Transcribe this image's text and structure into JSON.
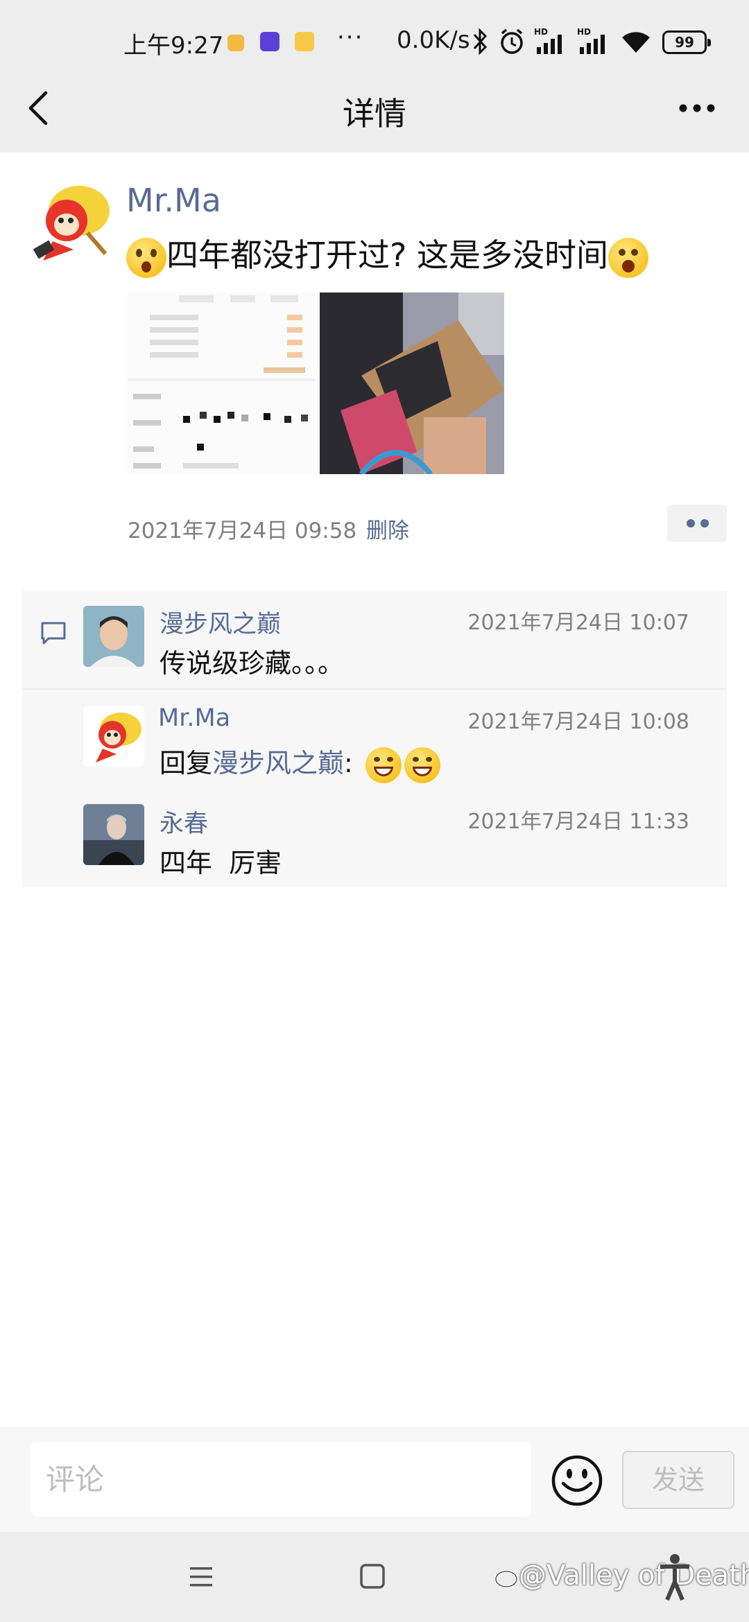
{
  "status_bar": {
    "time": "上午9:27",
    "more": "···",
    "network_speed": "0.0K/s",
    "battery": "99"
  },
  "nav": {
    "back_icon": "chevron-left",
    "title": "详情",
    "more_icon": "ellipsis"
  },
  "post": {
    "author": "Mr.Ma",
    "text": "四年都没打开过? 这是多没时间",
    "timestamp": "2021年7月24日 09:58",
    "delete_label": "删除",
    "actions_icon": "two-dots"
  },
  "comments": [
    {
      "author": "漫步风之巅",
      "time": "2021年7月24日 10:07",
      "text": "传说级珍藏。。。"
    },
    {
      "author": "Mr.Ma",
      "time": "2021年7月24日 10:08",
      "reply_prefix": "回复",
      "reply_to": "漫步风之巅",
      "reply_suffix": ":"
    },
    {
      "author": "永春",
      "time": "2021年7月24日 11:33",
      "text": "四年  厉害"
    }
  ],
  "input_bar": {
    "placeholder": "评论",
    "send_label": "发送",
    "emoji_icon": "smiley"
  },
  "watermark": "@Valley of Death",
  "colors": {
    "link": "#576b95",
    "bar_bg": "#ededed",
    "comment_bg": "#f7f7f7"
  }
}
